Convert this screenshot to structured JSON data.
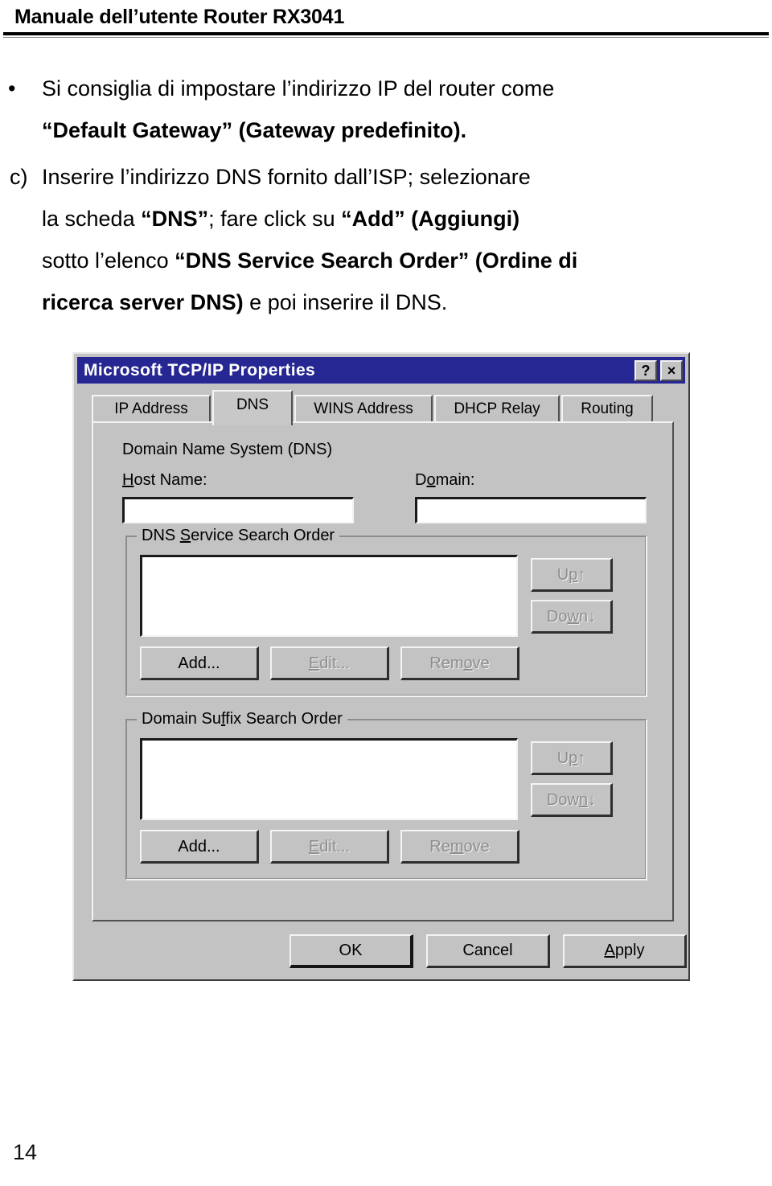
{
  "header": {
    "title": "Manuale dell’utente Router RX3041"
  },
  "body": {
    "bullet_marker": "•",
    "bullet_paragraph": {
      "line1": "Si consiglia di impostare l’indirizzo IP del router come",
      "line2_bold_a": "“Default Gateway” (Gateway predefinito)."
    },
    "list_item": {
      "marker": "c)",
      "line1": "Inserire l’indirizzo DNS fornito dall’ISP; selezionare",
      "line2_a": "la scheda ",
      "line2_b": "“DNS”",
      "line2_c": "; fare click su ",
      "line2_d": "“Add” (Aggiungi)",
      "line3_a": "sotto l’elenco ",
      "line3_b": "“DNS Service Search Order” (Ordine di",
      "line4_a": "ricerca server DNS)",
      "line4_b": " e poi inserire il DNS."
    }
  },
  "dialog": {
    "title": "Microsoft TCP/IP Properties",
    "help_button": "?",
    "close_button": "×",
    "tabs": [
      {
        "label": "IP Address",
        "active": false
      },
      {
        "label": "DNS",
        "active": true
      },
      {
        "label": "WINS Address",
        "active": false
      },
      {
        "label": "DHCP Relay",
        "active": false
      },
      {
        "label": "Routing",
        "active": false
      }
    ],
    "dns_page": {
      "heading": "Domain Name System (DNS)",
      "host_name_label_accel": "H",
      "host_name_label_rest": "ost Name:",
      "host_name_value": "",
      "domain_label_pre": "D",
      "domain_label_accel": "o",
      "domain_label_rest": "main:",
      "domain_value": "",
      "groups": [
        {
          "legend_pre": "DNS ",
          "legend_accel": "S",
          "legend_rest": "ervice Search Order",
          "list_items": [],
          "up_pre": "U",
          "up_accel": "p",
          "up_suffix": "↑",
          "down_pre": "Do",
          "down_accel": "w",
          "down_rest": "n",
          "down_suffix": "↓",
          "add_label": "Add...",
          "edit_pre": "",
          "edit_accel": "E",
          "edit_rest": "dit...",
          "remove_pre": "Rem",
          "remove_accel": "o",
          "remove_rest": "ve",
          "up_enabled": false,
          "down_enabled": false,
          "add_enabled": true,
          "edit_enabled": false,
          "remove_enabled": false
        },
        {
          "legend_pre": "Domain Su",
          "legend_accel": "f",
          "legend_rest": "fix Search Order",
          "list_items": [],
          "up_pre": "U",
          "up_accel": "p",
          "up_suffix": "↑",
          "down_pre": "Dow",
          "down_accel": "n",
          "down_rest": "",
          "down_suffix": "↓",
          "add_label": "Add...",
          "edit_pre": "",
          "edit_accel": "E",
          "edit_rest": "dit...",
          "remove_pre": "Re",
          "remove_accel": "m",
          "remove_rest": "ove",
          "up_enabled": false,
          "down_enabled": false,
          "add_enabled": true,
          "edit_enabled": false,
          "remove_enabled": false
        }
      ]
    },
    "buttons": {
      "ok": "OK",
      "cancel": "Cancel",
      "apply_accel": "A",
      "apply_rest": "pply"
    }
  },
  "footer": {
    "page_number": "14"
  },
  "colors": {
    "titlebar": "#272793",
    "dialog_face": "#c3c3c3",
    "field_bg": "#ffffff",
    "disabled_text": "#8d8d8d"
  }
}
